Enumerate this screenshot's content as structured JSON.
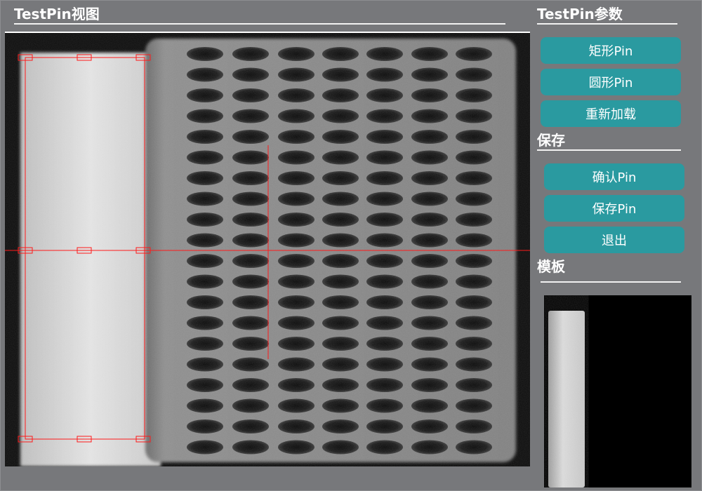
{
  "view_panel": {
    "title": "TestPin视图"
  },
  "params_panel": {
    "title": "TestPin参数",
    "buttons": {
      "rect_pin": "矩形Pin",
      "circle_pin": "圆形Pin",
      "reload": "重新加载"
    }
  },
  "save_section": {
    "title": "保存",
    "buttons": {
      "confirm_pin": "确认Pin",
      "save_pin": "保存Pin",
      "exit": "退出"
    }
  },
  "template_section": {
    "title": "模板"
  },
  "colors": {
    "background": "#77787b",
    "button": "#2a9aa0",
    "selection": "#ff1a1a",
    "crosshair": "#ff1a1a"
  },
  "icons": {}
}
